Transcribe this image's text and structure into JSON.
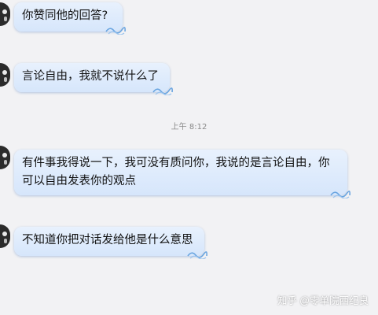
{
  "chat": {
    "messages": [
      {
        "text": "你赞同他的回答?"
      },
      {
        "text": "言论自由，我就不说什么了"
      },
      {
        "text": "有件事我得说一下，我可没有质问你，我说的是言论自由，你可以自由发表你的观点"
      },
      {
        "text": "不知道你把对话发给他是什么意思"
      }
    ],
    "timestamp": "上午 8:12"
  },
  "watermark": {
    "text": "知乎 @零单院西纪良"
  },
  "colors": {
    "background": "#f2f2f4",
    "bubble": "#dbe9fc",
    "bubble_shadow": "#6e9fd8",
    "timestamp": "#8a8a8a"
  }
}
